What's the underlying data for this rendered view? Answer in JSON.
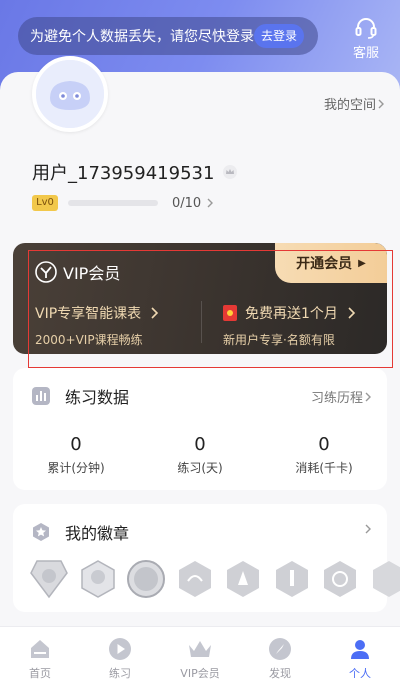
{
  "header": {
    "login_tip": "为避免个人数据丢失，请您尽快登录",
    "login_button": "去登录",
    "service_label": "客服"
  },
  "profile": {
    "my_space": "我的空间",
    "username": "用户_173959419531",
    "level_badge": "Lv0",
    "level_progress": "0/10",
    "level_fraction": 0
  },
  "vip": {
    "title": "VIP会员",
    "open_button": "开通会员",
    "left_title": "VIP专享智能课表",
    "left_sub": "2000+VIP课程畅练",
    "right_title": "免费再送1个月",
    "right_sub": "新用户专享·名额有限"
  },
  "practice": {
    "title": "练习数据",
    "history_link": "习练历程",
    "stats": [
      {
        "value": "0",
        "label": "累计(分钟)"
      },
      {
        "value": "0",
        "label": "练习(天)"
      },
      {
        "value": "0",
        "label": "消耗(千卡)"
      }
    ]
  },
  "badges": {
    "title": "我的徽章",
    "items": [
      "badge-1",
      "badge-2",
      "badge-3",
      "badge-4",
      "badge-5",
      "badge-6",
      "badge-7",
      "badge-8"
    ]
  },
  "tabbar": {
    "items": [
      {
        "label": "首页",
        "icon": "home-icon"
      },
      {
        "label": "练习",
        "icon": "play-icon"
      },
      {
        "label": "VIP会员",
        "icon": "crown-icon"
      },
      {
        "label": "发现",
        "icon": "compass-icon"
      },
      {
        "label": "个人",
        "icon": "person-icon"
      }
    ],
    "active_index": 4
  },
  "colors": {
    "accent": "#4c6ef5",
    "vip_gold": "#f3cd98",
    "vip_dark": "#3a332e"
  }
}
